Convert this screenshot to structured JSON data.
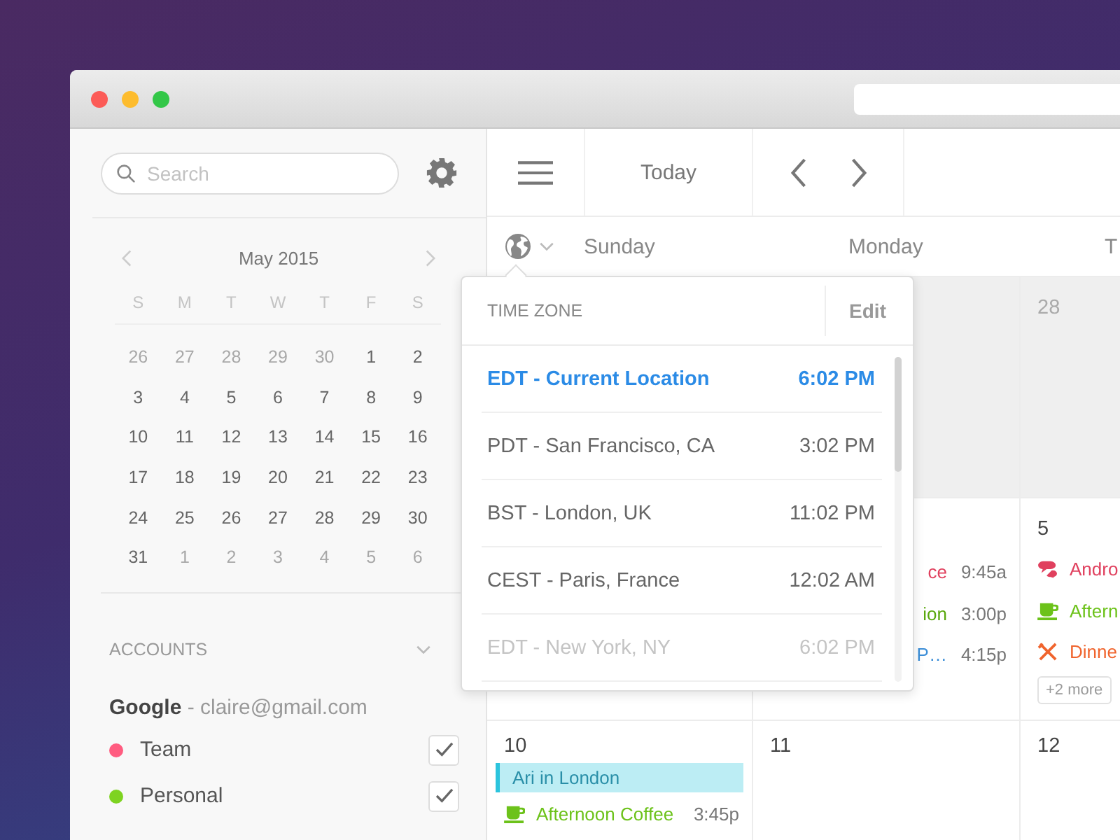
{
  "sidebar": {
    "search": {
      "placeholder": "Search"
    },
    "mini_calendar": {
      "title": "May 2015",
      "weekdays": [
        "S",
        "M",
        "T",
        "W",
        "T",
        "F",
        "S"
      ],
      "weeks": [
        [
          {
            "day": "26",
            "muted": true
          },
          {
            "day": "27",
            "muted": true
          },
          {
            "day": "28",
            "muted": true
          },
          {
            "day": "29",
            "muted": true
          },
          {
            "day": "30",
            "muted": true
          },
          {
            "day": "1",
            "muted": false
          },
          {
            "day": "2",
            "muted": false
          }
        ],
        [
          {
            "day": "3",
            "muted": false
          },
          {
            "day": "4",
            "muted": false
          },
          {
            "day": "5",
            "muted": false
          },
          {
            "day": "6",
            "muted": false
          },
          {
            "day": "7",
            "muted": false
          },
          {
            "day": "8",
            "muted": false
          },
          {
            "day": "9",
            "muted": false
          }
        ],
        [
          {
            "day": "10",
            "muted": false
          },
          {
            "day": "11",
            "muted": false
          },
          {
            "day": "12",
            "muted": false
          },
          {
            "day": "13",
            "muted": false
          },
          {
            "day": "14",
            "muted": false
          },
          {
            "day": "15",
            "muted": false
          },
          {
            "day": "16",
            "muted": false
          }
        ],
        [
          {
            "day": "17",
            "muted": false
          },
          {
            "day": "18",
            "muted": false
          },
          {
            "day": "19",
            "muted": false
          },
          {
            "day": "20",
            "muted": false
          },
          {
            "day": "21",
            "muted": false
          },
          {
            "day": "22",
            "muted": false
          },
          {
            "day": "23",
            "muted": false
          }
        ],
        [
          {
            "day": "24",
            "muted": false
          },
          {
            "day": "25",
            "muted": false
          },
          {
            "day": "26",
            "muted": false
          },
          {
            "day": "27",
            "muted": false
          },
          {
            "day": "28",
            "muted": false
          },
          {
            "day": "29",
            "muted": false
          },
          {
            "day": "30",
            "muted": false
          }
        ],
        [
          {
            "day": "31",
            "muted": false
          },
          {
            "day": "1",
            "muted": true
          },
          {
            "day": "2",
            "muted": true
          },
          {
            "day": "3",
            "muted": true
          },
          {
            "day": "4",
            "muted": true
          },
          {
            "day": "5",
            "muted": true
          },
          {
            "day": "6",
            "muted": true
          }
        ]
      ]
    },
    "accounts": {
      "heading": "ACCOUNTS",
      "account": "**Google** - claire@gmail.com",
      "calendars": [
        {
          "name": "Team",
          "color": "#ff5c80",
          "checked": true
        },
        {
          "name": "Personal",
          "color": "#7ed321",
          "checked": true
        }
      ]
    }
  },
  "toolbar": {
    "today": "Today"
  },
  "week_header": [
    "Sunday",
    "Monday",
    "T"
  ],
  "grid": {
    "rows": [
      [
        {},
        {
          "muted": true
        },
        {
          "muted": true,
          "date": "28"
        }
      ],
      [
        {},
        {
          "muted": false,
          "events": [
            {
              "kind": "plain",
              "title": "ce",
              "time": "9:45a",
              "color": "#e0405e"
            },
            {
              "kind": "plain",
              "title": "ion",
              "time": "3:00p",
              "color": "#5aa80e"
            },
            {
              "kind": "plain",
              "title": "P…",
              "time": "4:15p",
              "color": "#3d8fd8"
            }
          ]
        },
        {
          "muted": false,
          "date": "5",
          "events": [
            {
              "kind": "chat",
              "title": "Andro",
              "color": "#e0405e"
            },
            {
              "kind": "coffee",
              "title": "Aftern",
              "color": "#6cc21a"
            },
            {
              "kind": "dinner",
              "title": "Dinne",
              "color": "#f0642d"
            }
          ],
          "more": "+2 more"
        }
      ],
      [
        {
          "muted": false,
          "date": "10",
          "events": [
            {
              "kind": "allday",
              "title": "Ari in London",
              "color": "#2cc4dd"
            },
            {
              "kind": "coffee",
              "title": "Afternoon Coffee",
              "time": "3:45p",
              "color": "#6cc21a"
            }
          ]
        },
        {
          "muted": false,
          "date": "11"
        },
        {
          "muted": false,
          "date": "12"
        }
      ]
    ]
  },
  "timezone_popup": {
    "heading": "TIME ZONE",
    "action": "Edit",
    "zones": [
      {
        "name": "EDT - Current Location",
        "time": "6:02 PM",
        "selected": true,
        "faded": false
      },
      {
        "name": "PDT - San Francisco, CA",
        "time": "3:02 PM",
        "selected": false,
        "faded": false
      },
      {
        "name": "BST - London, UK",
        "time": "11:02 PM",
        "selected": false,
        "faded": false
      },
      {
        "name": "CEST - Paris, France",
        "time": "12:02 AM",
        "selected": false,
        "faded": false
      },
      {
        "name": "EDT - New York, NY",
        "time": "6:02 PM",
        "selected": false,
        "faded": true
      }
    ]
  }
}
